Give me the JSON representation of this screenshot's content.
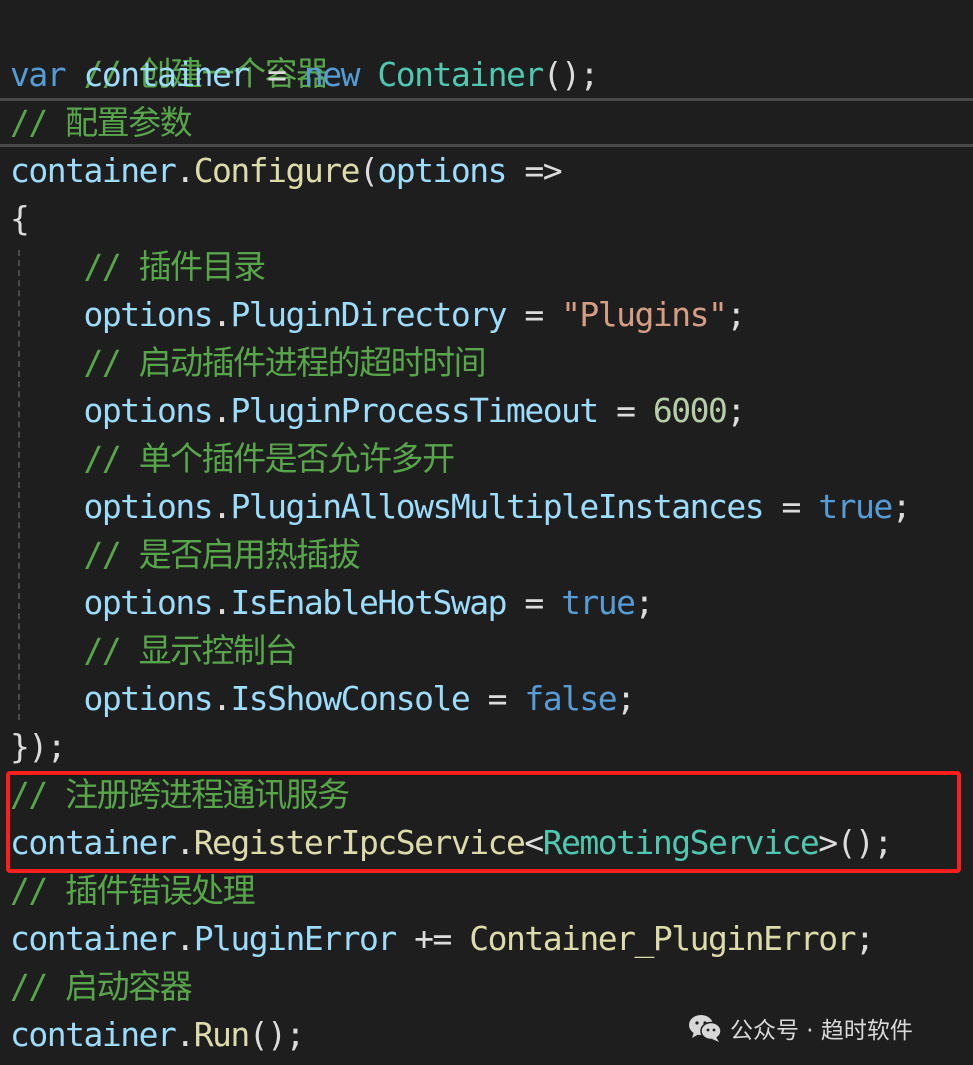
{
  "code": {
    "line1": {
      "comment": "// 创建一个容器"
    },
    "line2": {
      "kw_var": "var",
      "name": " container ",
      "eq": "= ",
      "kw_new": "new",
      "sp": " ",
      "type": "Container",
      "end": "();"
    },
    "line3": {
      "comment": "// 配置参数"
    },
    "line4": {
      "obj": "container",
      "dot": ".",
      "method": "Configure",
      "open": "(",
      "param": "options",
      "arrow": " =>"
    },
    "line5": {
      "brace": "{"
    },
    "line6": {
      "indent": "    ",
      "comment": "// 插件目录"
    },
    "line7": {
      "indent": "    ",
      "obj": "options",
      "dot": ".",
      "prop": "PluginDirectory",
      "eq": " = ",
      "str": "\"Plugins\"",
      "end": ";"
    },
    "line8": {
      "indent": "    ",
      "comment": "// 启动插件进程的超时时间"
    },
    "line9": {
      "indent": "    ",
      "obj": "options",
      "dot": ".",
      "prop": "PluginProcessTimeout",
      "eq": " = ",
      "num": "6000",
      "end": ";"
    },
    "line10": {
      "indent": "    ",
      "comment": "// 单个插件是否允许多开"
    },
    "line11": {
      "indent": "    ",
      "obj": "options",
      "dot": ".",
      "prop": "PluginAllowsMultipleInstances",
      "eq": " = ",
      "kw": "true",
      "end": ";"
    },
    "line12": {
      "indent": "    ",
      "comment": "// 是否启用热插拔"
    },
    "line13": {
      "indent": "    ",
      "obj": "options",
      "dot": ".",
      "prop": "IsEnableHotSwap",
      "eq": " = ",
      "kw": "true",
      "end": ";"
    },
    "line14": {
      "indent": "    ",
      "comment": "// 显示控制台"
    },
    "line15": {
      "indent": "    ",
      "obj": "options",
      "dot": ".",
      "prop": "IsShowConsole",
      "eq": " = ",
      "kw": "false",
      "end": ";"
    },
    "line16": {
      "close": "});"
    },
    "line17": {
      "comment": "// 注册跨进程通讯服务"
    },
    "line18": {
      "obj": "container",
      "dot": ".",
      "method": "RegisterIpcService",
      "lt": "<",
      "type": "RemotingService",
      "gt": ">",
      "end": "();"
    },
    "line19": {
      "comment": "// 插件错误处理"
    },
    "line20": {
      "obj": "container",
      "dot": ".",
      "prop": "PluginError",
      "op": " += ",
      "handler": "Container_PluginError",
      "end": ";"
    },
    "line21": {
      "comment": "// 启动容器"
    },
    "line22": {
      "obj": "container",
      "dot": ".",
      "method": "Run",
      "end": "();"
    }
  },
  "watermark": {
    "icon": "wechat-icon",
    "text": "公众号 · 趋时软件"
  },
  "colors": {
    "background": "#1e1e1e",
    "comment": "#57a64a",
    "keyword": "#569cd6",
    "type": "#4ec9b0",
    "identifier": "#9cdcfe",
    "method": "#dcdcaa",
    "string": "#d69d85",
    "number": "#b5cea8",
    "highlight": "#ff1e1e"
  }
}
